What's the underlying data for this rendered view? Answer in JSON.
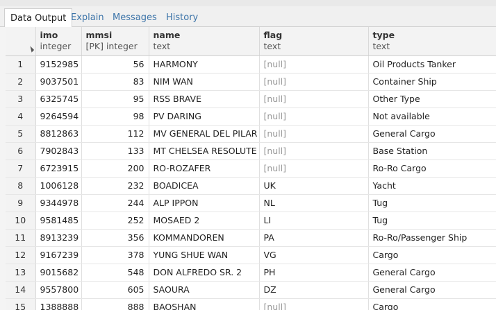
{
  "tabs": [
    {
      "label": "Data Output",
      "active": true
    },
    {
      "label": "Explain",
      "active": false
    },
    {
      "label": "Messages",
      "active": false
    },
    {
      "label": "History",
      "active": false
    }
  ],
  "columns": [
    {
      "name": "imo",
      "type": "integer"
    },
    {
      "name": "mmsi",
      "type": "[PK] integer"
    },
    {
      "name": "name",
      "type": "text"
    },
    {
      "name": "flag",
      "type": "text"
    },
    {
      "name": "type",
      "type": "text"
    }
  ],
  "rows": [
    {
      "n": "1",
      "imo": "9152985",
      "mmsi": "56",
      "name": "HARMONY",
      "flag": "[null]",
      "type": "Oil Products Tanker"
    },
    {
      "n": "2",
      "imo": "9037501",
      "mmsi": "83",
      "name": "NIM WAN",
      "flag": "[null]",
      "type": "Container Ship"
    },
    {
      "n": "3",
      "imo": "6325745",
      "mmsi": "95",
      "name": "RSS BRAVE",
      "flag": "[null]",
      "type": "Other Type"
    },
    {
      "n": "4",
      "imo": "9264594",
      "mmsi": "98",
      "name": "PV DARING",
      "flag": "[null]",
      "type": "Not available"
    },
    {
      "n": "5",
      "imo": "8812863",
      "mmsi": "112",
      "name": "MV GENERAL DEL PILAR",
      "flag": "[null]",
      "type": "General Cargo"
    },
    {
      "n": "6",
      "imo": "7902843",
      "mmsi": "133",
      "name": "MT CHELSEA RESOLUTE",
      "flag": "[null]",
      "type": "Base Station"
    },
    {
      "n": "7",
      "imo": "6723915",
      "mmsi": "200",
      "name": "RO-ROZAFER",
      "flag": "[null]",
      "type": "Ro-Ro Cargo"
    },
    {
      "n": "8",
      "imo": "1006128",
      "mmsi": "232",
      "name": "BOADICEA",
      "flag": "UK",
      "type": "Yacht"
    },
    {
      "n": "9",
      "imo": "9344978",
      "mmsi": "244",
      "name": "ALP IPPON",
      "flag": "NL",
      "type": "Tug"
    },
    {
      "n": "10",
      "imo": "9581485",
      "mmsi": "252",
      "name": "MOSAED 2",
      "flag": "LI",
      "type": "Tug"
    },
    {
      "n": "11",
      "imo": "8913239",
      "mmsi": "356",
      "name": "KOMMANDOREN",
      "flag": "PA",
      "type": "Ro-Ro/Passenger Ship"
    },
    {
      "n": "12",
      "imo": "9167239",
      "mmsi": "378",
      "name": "YUNG SHUE WAN",
      "flag": "VG",
      "type": "Cargo"
    },
    {
      "n": "13",
      "imo": "9015682",
      "mmsi": "548",
      "name": "DON ALFREDO SR. 2",
      "flag": "PH",
      "type": "General Cargo"
    },
    {
      "n": "14",
      "imo": "9557800",
      "mmsi": "605",
      "name": "SAOURA",
      "flag": "DZ",
      "type": "General Cargo"
    },
    {
      "n": "15",
      "imo": "1388888",
      "mmsi": "888",
      "name": "BAOSHAN",
      "flag": "[null]",
      "type": "Cargo"
    }
  ]
}
